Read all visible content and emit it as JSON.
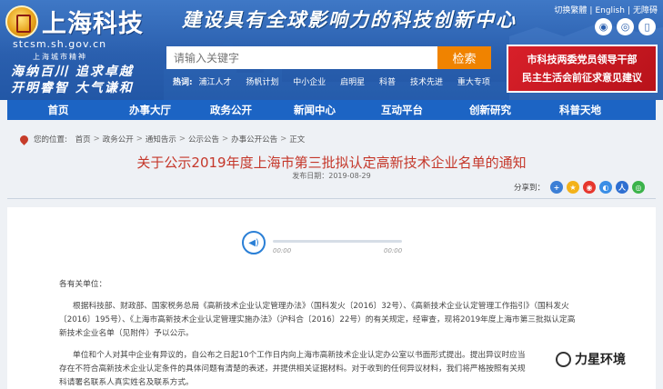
{
  "header": {
    "logo_cn": "上海科技",
    "logo_domain": "stcsm.sh.gov.cn",
    "spirit_label": "上海城市精神",
    "spirit_line1": "海纳百川  追求卓越",
    "spirit_line2": "开明睿智  大气谦和",
    "slogan": "建设具有全球影响力的科技创新中心",
    "top_links": [
      "切换繁體",
      "English",
      "无障碍"
    ],
    "search_placeholder": "请输入关键字",
    "search_button": "检索",
    "hot_label": "热词:",
    "hot_tags": [
      "浦江人才",
      "扬帆计划",
      "中小企业",
      "启明星",
      "科普",
      "技术先进",
      "重大专项"
    ],
    "banner_line1": "市科技两委党员领导干部",
    "banner_line2": "民主生活会前征求意见建议"
  },
  "nav": {
    "items": [
      "首页",
      "办事大厅",
      "政务公开",
      "新闻中心",
      "互动平台",
      "创新研究",
      "科普天地"
    ]
  },
  "breadcrumb": {
    "label": "您的位置:",
    "items": [
      "首页",
      "政务公开",
      "通知告示",
      "公示公告",
      "办事公开公告",
      "正文"
    ]
  },
  "article": {
    "title": "关于公示2019年度上海市第三批拟认定高新技术企业名单的通知",
    "pubdate": "发布日期：2019-08-29",
    "share_label": "分享到：",
    "audio_start": "00:00",
    "audio_end": "00:00",
    "greeting": "各有关单位：",
    "p1_line1": "根据科技部、财政部、国家税务总局《高新技术企业认定管理办法》（国科发火〔2016〕32号）、《高新技术企业认定管理工作指引》（国科发火",
    "p1_line2": "〔2016〕195号）、《上海市高新技术企业认定管理实施办法》（沪科合〔2016〕22号）的有关规定，经审查，现将2019年度上海市第三批拟认定高",
    "p1_line3": "新技术企业名单（见附件）予以公示。",
    "p2_line1": "单位和个人对其中企业有异议的，自公布之日起10个工作日内向上海市高新技术企业认定办公室以书面形式提出。提出异议时应当",
    "p2_line2": "存在不符合高新技术企业认定条件的具体问题有清楚的表述，并提供相关证据材料。对于收到的任何异议材料，我们将严格按照有关规",
    "p2_line3": "科请署名联系人真实姓名及联系方式。"
  },
  "watermark": "力星环境",
  "colors": {
    "header_blue": "#2a5fae",
    "nav_blue": "#1c64c4",
    "search_orange": "#f08300",
    "title_red": "#c5372a",
    "banner_red": "#d8202a"
  }
}
